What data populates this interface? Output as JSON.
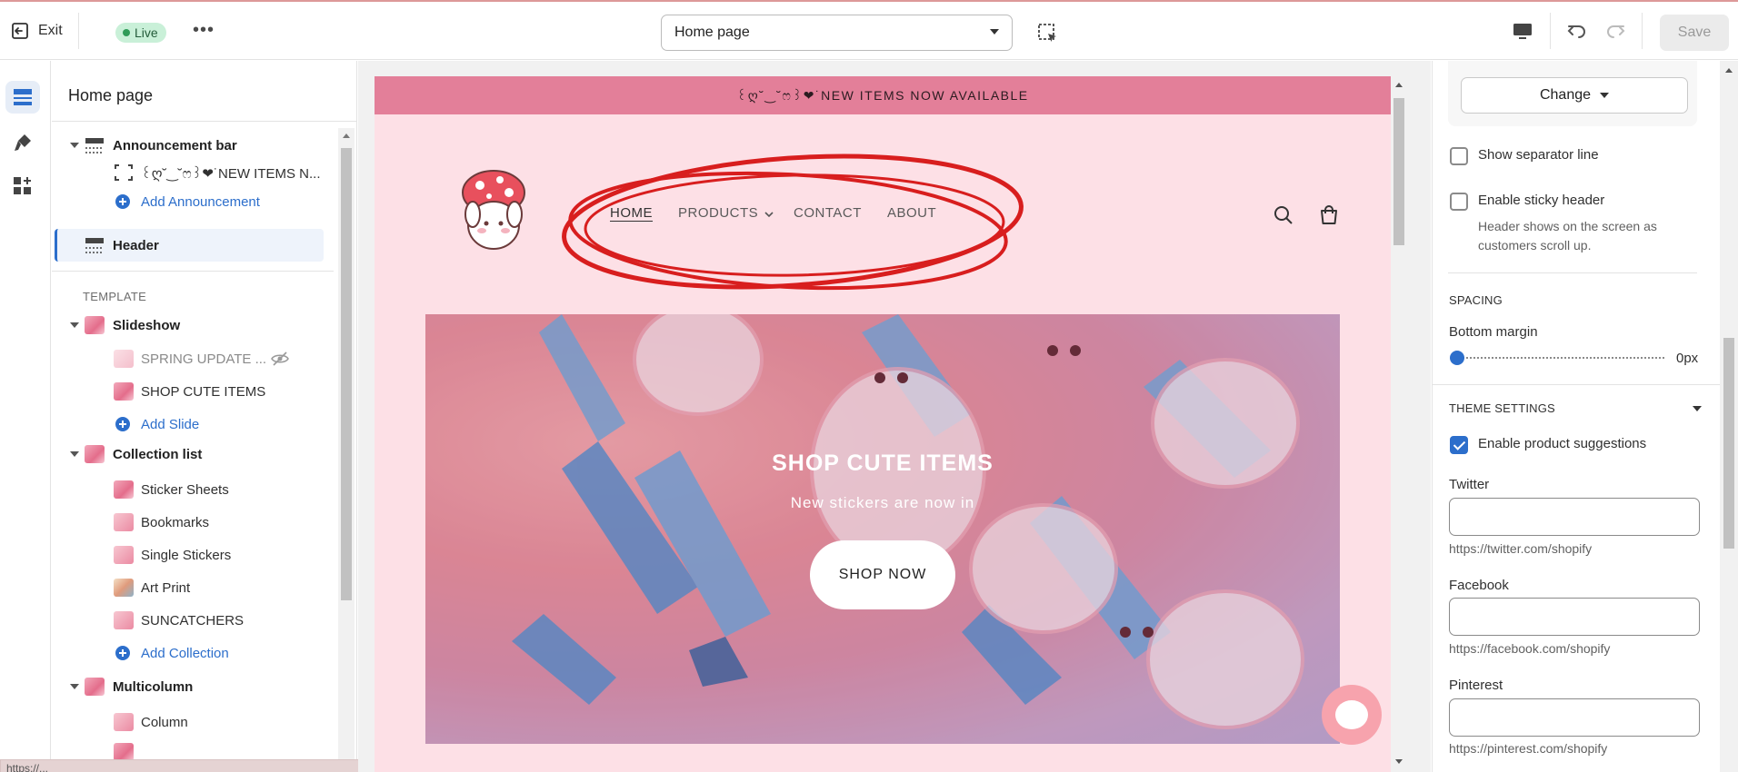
{
  "topbar": {
    "exit_label": "Exit",
    "status_badge": "Live",
    "more_label": "•••",
    "page_select_value": "Home page",
    "save_label": "Save"
  },
  "sections": {
    "title": "Home page",
    "announcement_bar": "Announcement bar",
    "announcement_item": "꒰ღ˘‿˘ෆ꒱❤︎˙NEW ITEMS N...",
    "add_announcement": "Add Announcement",
    "header": "Header",
    "template_label": "TEMPLATE",
    "slideshow": "Slideshow",
    "slides": [
      "SPRING UPDATE ...",
      "SHOP CUTE ITEMS"
    ],
    "add_slide": "Add Slide",
    "collection_list": "Collection list",
    "collections": [
      "Sticker Sheets",
      "Bookmarks",
      "Single Stickers",
      "Art Print",
      "SUNCATCHERS"
    ],
    "add_collection": "Add Collection",
    "multicolumn": "Multicolumn",
    "columns": [
      "Column"
    ]
  },
  "url_tip": "https://...",
  "preview": {
    "announcement_text": "꒰ღ˘‿˘ෆ꒱❤︎˙NEW ITEMS NOW AVAILABLE",
    "nav": [
      "HOME",
      "PRODUCTS",
      "CONTACT",
      "ABOUT"
    ],
    "hero_title": "SHOP CUTE ITEMS",
    "hero_subtitle": "New stickers are now in",
    "hero_button": "SHOP NOW"
  },
  "settings": {
    "change_label": "Change",
    "show_separator": "Show separator line",
    "sticky_header": "Enable sticky header",
    "sticky_help": "Header shows on the screen as customers scroll up.",
    "spacing_caption": "SPACING",
    "bottom_margin_label": "Bottom margin",
    "bottom_margin_value": "0px",
    "bottom_margin_level": 0,
    "theme_settings_caption": "THEME SETTINGS",
    "product_suggestions": "Enable product suggestions",
    "twitter_label": "Twitter",
    "twitter_hint": "https://twitter.com/shopify",
    "facebook_label": "Facebook",
    "facebook_hint": "https://facebook.com/shopify",
    "pinterest_label": "Pinterest",
    "pinterest_hint": "https://pinterest.com/shopify"
  },
  "colors": {
    "accent": "#2c6ecb",
    "announcement_bg": "#e37f99",
    "preview_bg": "#fde0e6",
    "live_badge": "#c9f0d8",
    "annotation_red": "#d81e1e"
  }
}
